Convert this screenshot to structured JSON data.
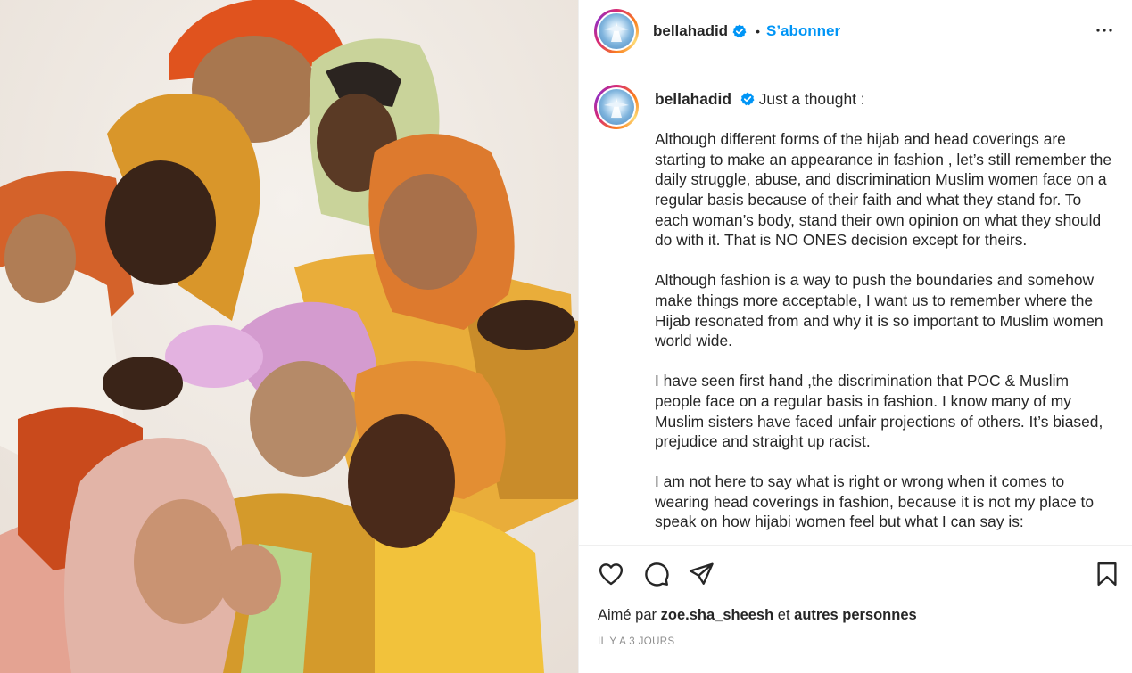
{
  "post": {
    "photo_icon": "group-portrait-photo",
    "author": "bellahadid",
    "verified_icon": "verified-badge-icon",
    "follow_label": "S’abonner",
    "separator": "•",
    "more_icon": "more-options-icon"
  },
  "caption": {
    "username": "bellahadid",
    "first_line": "Just a thought :",
    "paragraphs": [
      "Although different forms of the hijab and head coverings are starting to make an appearance in fashion , let’s still remember the daily struggle, abuse, and discrimination Muslim women face on a regular basis because of their faith and what they stand for. To each woman’s body, stand their own opinion on what they should do with it. That is NO ONES decision except for theirs.",
      "Although fashion is a way to push the boundaries and somehow make things more acceptable, I want us to remember where the Hijab resonated from and why it is so important to Muslim women world wide.",
      "I have seen first hand ,the discrimination that POC & Muslim people face on a regular basis in fashion. I know many of my Muslim sisters have faced unfair projections of others. It’s biased, prejudice and straight up racist.",
      "I am not here to say what is right or wrong when it comes to wearing head coverings in fashion, because it is not my place to speak on how hijabi women feel but what I can say is:"
    ]
  },
  "actions": {
    "icons": [
      "heart-icon",
      "comment-icon",
      "share-icon",
      "bookmark-icon"
    ],
    "likes_prefix": "Aimé par",
    "likes_user": "zoe.sha_sheesh",
    "likes_middle": "et",
    "likes_suffix": "autres personnes",
    "timestamp": "IL Y A 3 JOURS"
  },
  "colors": {
    "accent": "#0095f6",
    "text": "#262626",
    "muted": "#8e8e8e",
    "border": "#efefef"
  }
}
